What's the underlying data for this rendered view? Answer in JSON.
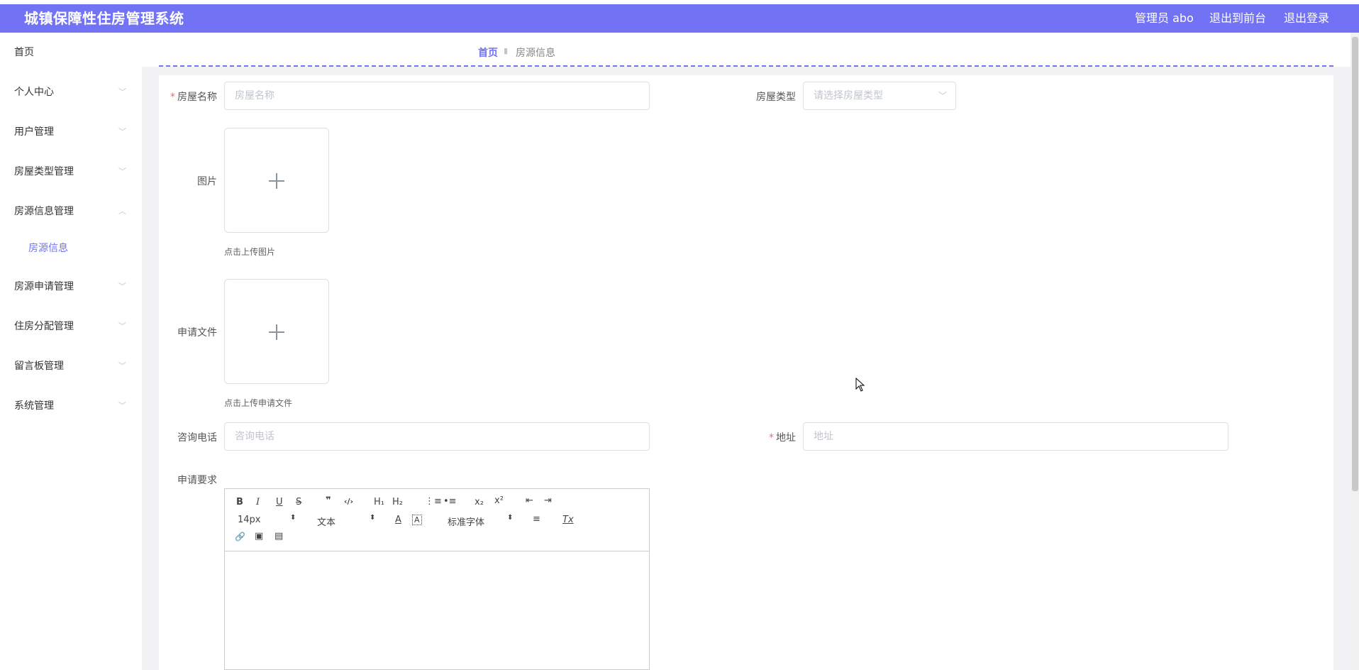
{
  "header": {
    "title": "城镇保障性住房管理系统",
    "user": "管理员 abo",
    "to_front": "退出到前台",
    "logout": "退出登录"
  },
  "sidebar": {
    "items": [
      {
        "label": "首页"
      },
      {
        "label": "个人中心"
      },
      {
        "label": "用户管理"
      },
      {
        "label": "房屋类型管理"
      },
      {
        "label": "房源信息管理"
      },
      {
        "label": "房源申请管理"
      },
      {
        "label": "住房分配管理"
      },
      {
        "label": "留言板管理"
      },
      {
        "label": "系统管理"
      }
    ],
    "subitem": "房源信息"
  },
  "breadcrumb": {
    "home": "首页",
    "current": "房源信息"
  },
  "form": {
    "name_label": "房屋名称",
    "name_placeholder": "房屋名称",
    "type_label": "房屋类型",
    "type_placeholder": "请选择房屋类型",
    "image_label": "图片",
    "image_tip": "点击上传图片",
    "file_label": "申请文件",
    "file_tip": "点击上传申请文件",
    "phone_label": "咨询电话",
    "phone_placeholder": "咨询电话",
    "address_label": "地址",
    "address_placeholder": "地址",
    "req_label": "申请要求"
  },
  "editor": {
    "bold": "B",
    "italic": "I",
    "underline": "U",
    "strike": "S",
    "quote": "❞",
    "code": "‹/›",
    "h1": "H₁",
    "h2": "H₂",
    "ol": "⋮≡",
    "ul": "•≡",
    "sub": "x₂",
    "sup": "x²",
    "outdent": "⇤",
    "indent": "⇥",
    "font_size": "14px",
    "heading": "文本",
    "color": "A",
    "background": "A",
    "font_family": "标准字体",
    "align": "≡",
    "clean": "Tx",
    "link": "🔗",
    "image": "▣",
    "video": "▤"
  },
  "colors": {
    "accent": "#7272f4",
    "required": "#f56c6c"
  }
}
